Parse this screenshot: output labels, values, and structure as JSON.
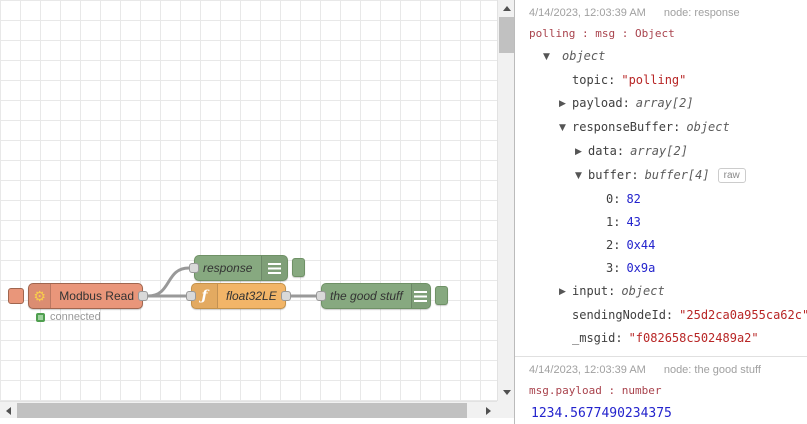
{
  "canvas": {
    "modbus": {
      "label": "Modbus Read",
      "icon": "⚙",
      "status": "connected"
    },
    "response": {
      "label": "response"
    },
    "func": {
      "label": "float32LE",
      "icon": "ƒ"
    },
    "good": {
      "label": "the good stuff"
    }
  },
  "debug": {
    "raw_label": "raw",
    "msg1": {
      "timestamp": "4/14/2023, 12:03:39 AM",
      "node": "node: response",
      "path": "polling : msg : Object",
      "rows": [
        {
          "arrow": "▼",
          "type": "object"
        },
        {
          "key": "topic:",
          "value": "\"polling\""
        },
        {
          "arrow": "▶",
          "key": "payload:",
          "type": "array[2]"
        },
        {
          "arrow": "▼",
          "key": "responseBuffer:",
          "type": "object"
        },
        {
          "arrow": "▶",
          "key": "data:",
          "type": "array[2]"
        },
        {
          "arrow": "▼",
          "key": "buffer:",
          "type": "buffer[4]"
        },
        {
          "key": "0:",
          "value": "82"
        },
        {
          "key": "1:",
          "value": "43"
        },
        {
          "key": "2:",
          "value": "0x44"
        },
        {
          "key": "3:",
          "value": "0x9a"
        },
        {
          "arrow": "▶",
          "key": "input:",
          "type": "object"
        },
        {
          "key": "sendingNodeId:",
          "value": "\"25d2ca0a955ca62c\""
        },
        {
          "key": "_msgid:",
          "value": "\"f082658c502489a2\""
        }
      ]
    },
    "msg2": {
      "timestamp": "4/14/2023, 12:03:39 AM",
      "node": "node: the good stuff",
      "path": "msg.payload : number",
      "value": "1234.5677490234375"
    }
  }
}
